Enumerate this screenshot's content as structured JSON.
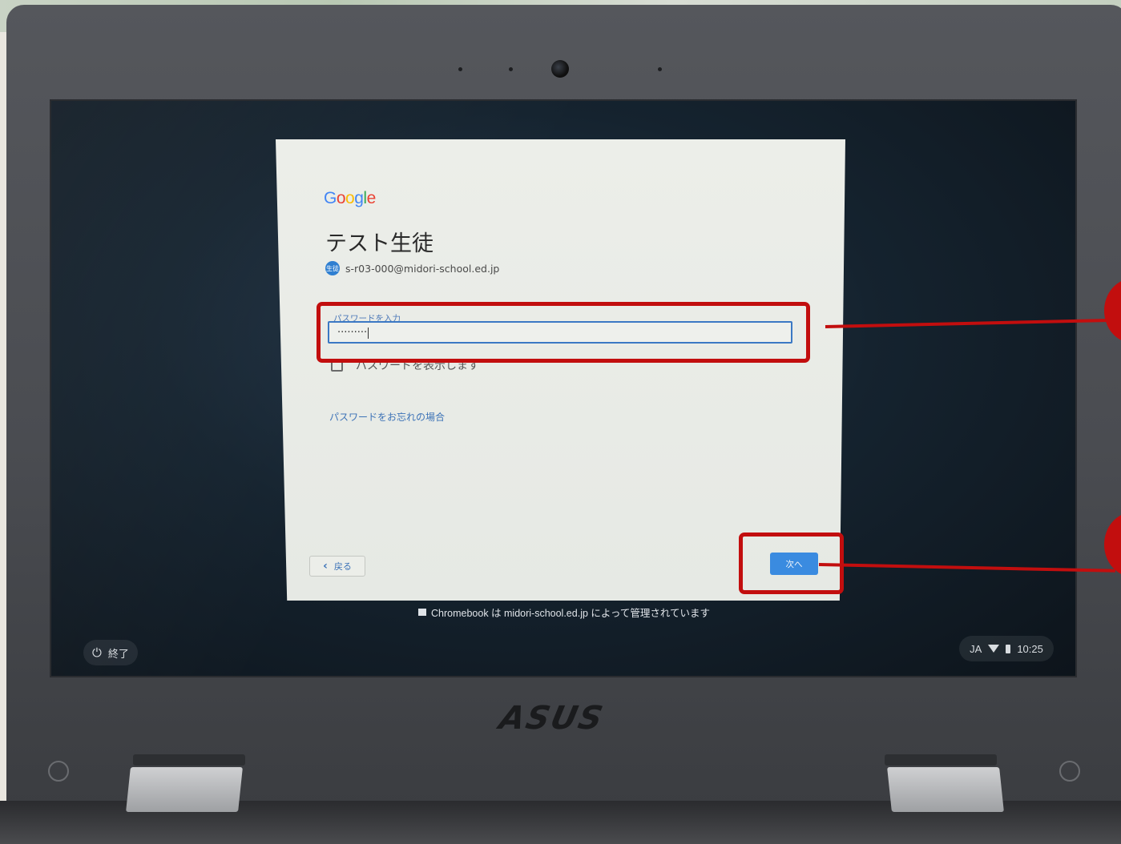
{
  "google_logo": {
    "letters": [
      {
        "char": "G",
        "color": "#4285F4"
      },
      {
        "char": "o",
        "color": "#EA4335"
      },
      {
        "char": "o",
        "color": "#FBBC05"
      },
      {
        "char": "g",
        "color": "#4285F4"
      },
      {
        "char": "l",
        "color": "#34A853"
      },
      {
        "char": "e",
        "color": "#EA4335"
      }
    ]
  },
  "account": {
    "display_name": "テスト生徒",
    "avatar_text": "生徒",
    "email": "s-r03-000@midori-school.ed.jp"
  },
  "password": {
    "label": "パスワードを入力",
    "masked_value": "·········",
    "show_label": "パスワードを表示します",
    "forgot_link": "パスワードをお忘れの場合"
  },
  "buttons": {
    "back_label": "戻る",
    "back_icon": "chevron-left-icon",
    "next_label": "次へ"
  },
  "footer": {
    "managed_notice": "Chromebook は midori-school.ed.jp によって管理されています",
    "shutdown_label": "終了",
    "shutdown_icon": "power-icon",
    "ime": "JA",
    "time": "10:25"
  },
  "device": {
    "brand": "ASUS"
  },
  "annotation_color": "#c20e0e"
}
